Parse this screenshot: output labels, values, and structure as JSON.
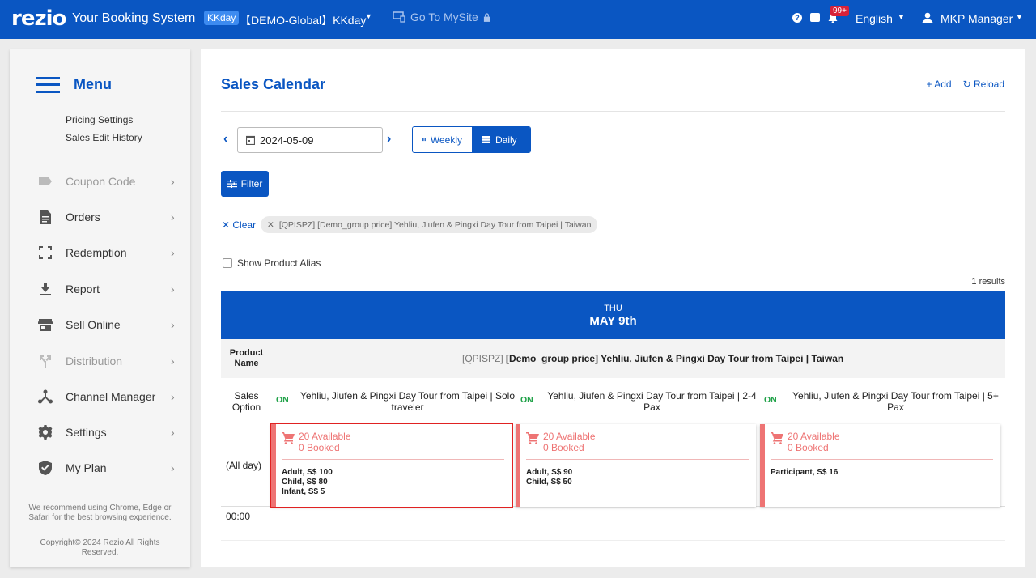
{
  "topbar": {
    "logo": "rezio",
    "app_title": "Your Booking System",
    "tenant_tag": "KKday",
    "tenant_name": "【DEMO-Global】KKday",
    "mysite": "Go To MySite",
    "notif_badge": "99+",
    "language": "English",
    "user": "MKP Manager"
  },
  "sidebar": {
    "title": "Menu",
    "sub_items": [
      "Pricing Settings",
      "Sales Edit History"
    ],
    "items": [
      {
        "label": "Coupon Code",
        "icon": "tag-icon",
        "disabled": true
      },
      {
        "label": "Orders",
        "icon": "document-icon"
      },
      {
        "label": "Redemption",
        "icon": "scan-icon"
      },
      {
        "label": "Report",
        "icon": "download-icon"
      },
      {
        "label": "Sell Online",
        "icon": "store-icon"
      },
      {
        "label": "Distribution",
        "icon": "fork-icon",
        "disabled": true
      },
      {
        "label": "Channel Manager",
        "icon": "hub-icon"
      },
      {
        "label": "Settings",
        "icon": "gear-icon"
      },
      {
        "label": "My Plan",
        "icon": "shield-check-icon"
      }
    ],
    "browser_note": "We recommend using Chrome, Edge or Safari for the best browsing experience.",
    "copyright": "Copyright© 2024 Rezio All Rights Reserved."
  },
  "main": {
    "title": "Sales Calendar",
    "add_label": "+ Add",
    "reload_label": "Reload",
    "date_value": "2024-05-09",
    "weekly_label": "Weekly",
    "daily_label": "Daily",
    "filter_label": "Filter",
    "clear_label": "Clear",
    "filter_chip": "[QPISPZ] [Demo_group price] Yehliu, Jiufen & Pingxi Day Tour from Taipei | Taiwan",
    "show_alias_label": "Show Product Alias",
    "results": "1 results",
    "day_of_week": "THU",
    "day_month": "MAY 9th",
    "product_name_label": "Product Name",
    "product_code": "[QPISPZ]",
    "product_name": "[Demo_group price] Yehliu, Jiufen & Pingxi Day Tour from Taipei | Taiwan",
    "sales_option_label": "Sales Option",
    "options": [
      {
        "status": "ON",
        "name": "Yehliu, Jiufen & Pingxi Day Tour from Taipei | Solo traveler"
      },
      {
        "status": "ON",
        "name": "Yehliu, Jiufen & Pingxi Day Tour from Taipei | 2-4 Pax"
      },
      {
        "status": "ON",
        "name": "Yehliu, Jiufen & Pingxi Day Tour from Taipei | 5+ Pax"
      }
    ],
    "slot_label": "(All day)",
    "slots": [
      {
        "available": "20 Available",
        "booked": "0 Booked",
        "prices": [
          "Adult, S$ 100",
          "Child, S$ 80",
          "Infant, S$ 5"
        ]
      },
      {
        "available": "20 Available",
        "booked": "0 Booked",
        "prices": [
          "Adult, S$ 90",
          "Child, S$ 50"
        ]
      },
      {
        "available": "20 Available",
        "booked": "0 Booked",
        "prices": [
          "Participant, S$ 16"
        ]
      }
    ],
    "time_label": "00:00"
  }
}
